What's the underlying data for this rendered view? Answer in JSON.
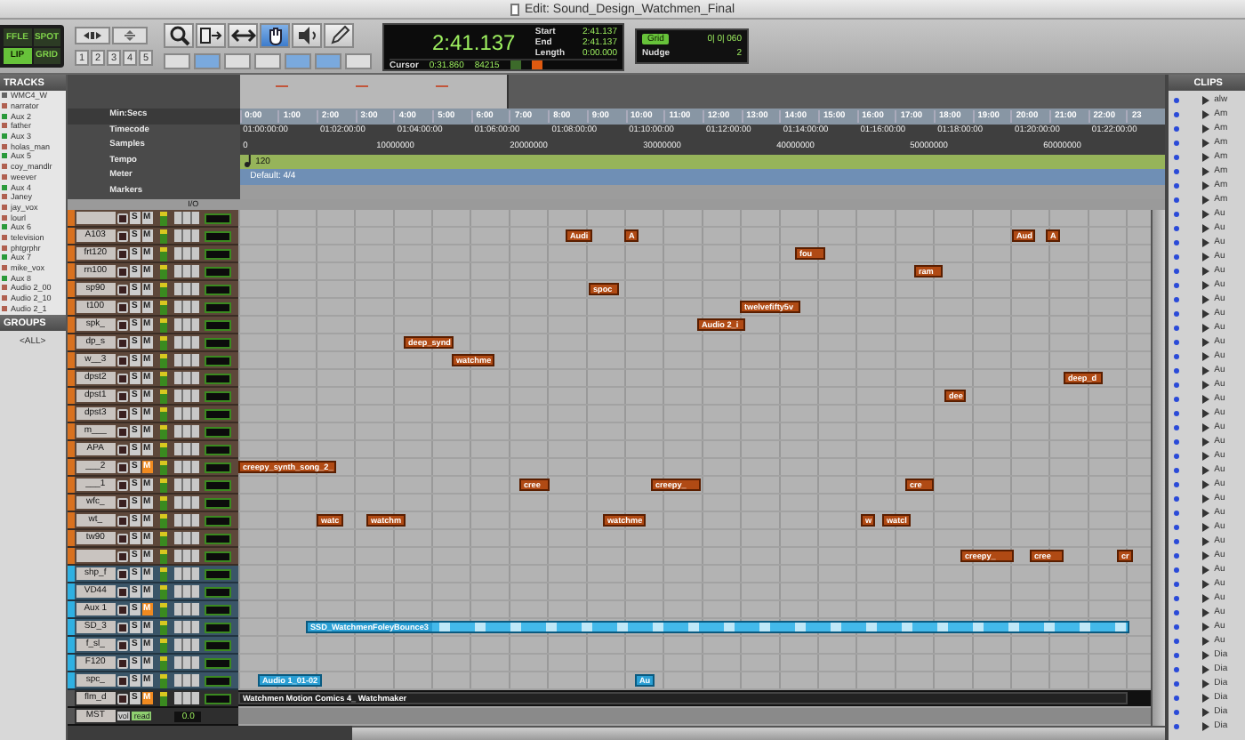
{
  "window": {
    "title": "Edit: Sound_Design_Watchmen_Final"
  },
  "toolbar": {
    "edit_modes": [
      {
        "label": "FFLE",
        "selected": false
      },
      {
        "label": "SPOT",
        "selected": false
      },
      {
        "label": "LIP",
        "selected": true
      },
      {
        "label": "GRID",
        "selected": false
      }
    ],
    "zoom_presets": [
      "1",
      "2",
      "3",
      "4",
      "5"
    ],
    "toggles": [
      {
        "on": false
      },
      {
        "on": true
      },
      {
        "on": false
      },
      {
        "on": false
      },
      {
        "on": true
      },
      {
        "on": true
      },
      {
        "on": false
      }
    ],
    "tools": [
      {
        "kind": "zoom",
        "selected": false
      },
      {
        "kind": "trim",
        "selected": false
      },
      {
        "kind": "select",
        "selected": false
      },
      {
        "kind": "grabber",
        "selected": true
      },
      {
        "kind": "scrub",
        "selected": false
      },
      {
        "kind": "pencil",
        "selected": false
      }
    ]
  },
  "counter": {
    "main": "2:41.137",
    "start_label": "Start",
    "start": "2:41.137",
    "end_label": "End",
    "end": "2:41.137",
    "length_label": "Length",
    "length": "0:00.000",
    "cursor_label": "Cursor",
    "cursor": "0:31.860",
    "sample": "84215"
  },
  "grid": {
    "label": "Grid",
    "value": "0| 0| 060",
    "nudge_label": "Nudge",
    "nudge": "2"
  },
  "tracks_panel": {
    "title": "TRACKS",
    "items": [
      {
        "name": "WMC4_W",
        "kind": "video"
      },
      {
        "name": "narrator",
        "kind": "audio"
      },
      {
        "name": "Aux 2",
        "kind": "aux"
      },
      {
        "name": "father",
        "kind": "audio"
      },
      {
        "name": "Aux 3",
        "kind": "aux"
      },
      {
        "name": "holas_man",
        "kind": "audio"
      },
      {
        "name": "Aux 5",
        "kind": "aux"
      },
      {
        "name": "coy_mandlr",
        "kind": "audio"
      },
      {
        "name": "weever",
        "kind": "audio"
      },
      {
        "name": "Aux 4",
        "kind": "aux"
      },
      {
        "name": "Janey",
        "kind": "audio"
      },
      {
        "name": "jay_vox",
        "kind": "audio"
      },
      {
        "name": "lourl",
        "kind": "audio"
      },
      {
        "name": "Aux 6",
        "kind": "aux"
      },
      {
        "name": "television",
        "kind": "audio"
      },
      {
        "name": "phtgrphr",
        "kind": "audio"
      },
      {
        "name": "Aux 7",
        "kind": "aux"
      },
      {
        "name": "mike_vox",
        "kind": "audio"
      },
      {
        "name": "Aux 8",
        "kind": "aux"
      },
      {
        "name": "Audio 2_00",
        "kind": "audio"
      },
      {
        "name": "Audio 2_10",
        "kind": "audio"
      },
      {
        "name": "Audio 2_1",
        "kind": "audio"
      }
    ]
  },
  "groups_panel": {
    "title": "GROUPS",
    "items": [
      "<ALL>"
    ]
  },
  "rulers": [
    {
      "label": "Min:Secs",
      "kind": "minsecs",
      "ticks": [
        "0:00",
        "1:00",
        "2:00",
        "3:00",
        "4:00",
        "5:00",
        "6:00",
        "7:00",
        "8:00",
        "9:00",
        "10:00",
        "11:00",
        "12:00",
        "13:00",
        "14:00",
        "15:00",
        "16:00",
        "17:00",
        "18:00",
        "19:00",
        "20:00",
        "21:00",
        "22:00",
        "23"
      ]
    },
    {
      "label": "Timecode",
      "kind": "timecode",
      "ticks": [
        "01:00:00:00",
        "01:02:00:00",
        "01:04:00:00",
        "01:06:00:00",
        "01:08:00:00",
        "01:10:00:00",
        "01:12:00:00",
        "01:14:00:00",
        "01:16:00:00",
        "01:18:00:00",
        "01:20:00:00",
        "01:22:00:00"
      ]
    },
    {
      "label": "Samples",
      "kind": "samples",
      "ticks": [
        "0",
        "10000000",
        "20000000",
        "30000000",
        "40000000",
        "50000000",
        "60000000"
      ]
    },
    {
      "label": "Tempo",
      "kind": "tempo",
      "value": "120"
    },
    {
      "label": "Meter",
      "kind": "meter",
      "value": "Default: 4/4"
    },
    {
      "label": "Markers",
      "kind": "markers"
    }
  ],
  "track_header": {
    "io_label": "I/O"
  },
  "tracks": [
    {
      "kind": "audio",
      "solo": "S",
      "mute": "M",
      "muted": false
    },
    {
      "name": "A103",
      "kind": "audio",
      "solo": "S",
      "mute": "M",
      "muted": false,
      "clips": [
        {
          "label": "Audi"
        },
        {
          "label": "A"
        },
        {
          "label": "Aud"
        },
        {
          "label": "A"
        }
      ]
    },
    {
      "name": "frt120",
      "kind": "audio",
      "solo": "S",
      "mute": "M",
      "muted": false,
      "clips": [
        {
          "label": "fou"
        }
      ]
    },
    {
      "name": "rn100",
      "kind": "audio",
      "solo": "S",
      "mute": "M",
      "muted": false,
      "clips": [
        {
          "label": "ram"
        }
      ]
    },
    {
      "name": "sp90",
      "kind": "audio",
      "solo": "S",
      "mute": "M",
      "muted": false,
      "clips": [
        {
          "label": "spoc"
        }
      ]
    },
    {
      "name": "t100",
      "kind": "audio",
      "solo": "S",
      "mute": "M",
      "muted": false,
      "clips": [
        {
          "label": "twelvefifty5v"
        }
      ]
    },
    {
      "name": "spk_",
      "kind": "audio",
      "solo": "S",
      "mute": "M",
      "muted": false,
      "clips": [
        {
          "label": "Audio 2_i"
        }
      ]
    },
    {
      "name": "dp_s",
      "kind": "audio",
      "solo": "S",
      "mute": "M",
      "muted": false,
      "clips": [
        {
          "label": "deep_synd"
        }
      ]
    },
    {
      "name": "w__3",
      "kind": "audio",
      "solo": "S",
      "mute": "M",
      "muted": false,
      "clips": [
        {
          "label": "watchme"
        }
      ]
    },
    {
      "name": "dpst2",
      "kind": "audio",
      "solo": "S",
      "mute": "M",
      "muted": false,
      "clips": [
        {
          "label": "deep_d"
        }
      ]
    },
    {
      "name": "dpst1",
      "kind": "audio",
      "solo": "S",
      "mute": "M",
      "muted": false,
      "clips": [
        {
          "label": "dee"
        }
      ]
    },
    {
      "name": "dpst3",
      "kind": "audio",
      "solo": "S",
      "mute": "M",
      "muted": false
    },
    {
      "name": "m___",
      "kind": "audio",
      "solo": "S",
      "mute": "M",
      "muted": false
    },
    {
      "name": "APA",
      "kind": "audio",
      "solo": "S",
      "mute": "M",
      "muted": false
    },
    {
      "name": "___2",
      "kind": "audio",
      "solo": "S",
      "mute": "M",
      "muted": true,
      "clips": [
        {
          "label": "creepy_synth_song_2_"
        }
      ]
    },
    {
      "name": "___1",
      "kind": "audio",
      "solo": "S",
      "mute": "M",
      "muted": false,
      "clips": [
        {
          "label": "cree"
        },
        {
          "label": "creepy_"
        },
        {
          "label": "cre"
        }
      ]
    },
    {
      "name": "wfc_",
      "kind": "audio",
      "solo": "S",
      "mute": "M",
      "muted": false
    },
    {
      "name": "wt_",
      "kind": "audio",
      "solo": "S",
      "mute": "M",
      "muted": false,
      "clips": [
        {
          "label": "watc"
        },
        {
          "label": "watchm"
        },
        {
          "label": "watchme"
        },
        {
          "label": "w"
        },
        {
          "label": "watcl"
        }
      ]
    },
    {
      "name": "tw90",
      "kind": "audio",
      "solo": "S",
      "mute": "M",
      "muted": false
    },
    {
      "kind": "audio",
      "solo": "S",
      "mute": "M",
      "muted": false,
      "clips": [
        {
          "label": "creepy_"
        },
        {
          "label": "cree"
        },
        {
          "label": "cr"
        }
      ]
    },
    {
      "name": "shp_f",
      "kind": "aux",
      "solo": "S",
      "mute": "M",
      "muted": false
    },
    {
      "name": "VD44",
      "kind": "aux",
      "solo": "S",
      "mute": "M",
      "muted": false
    },
    {
      "name": "Aux 1",
      "kind": "aux",
      "solo": "S",
      "mute": "M",
      "muted": true
    },
    {
      "name": "SD_3",
      "kind": "aux",
      "solo": "S",
      "mute": "M",
      "muted": false,
      "clips": [
        {
          "label": "SSD_WatchmenFoleyBounce3"
        }
      ]
    },
    {
      "name": "f_sl_",
      "kind": "aux",
      "solo": "S",
      "mute": "M",
      "muted": false
    },
    {
      "name": "F120",
      "kind": "aux",
      "solo": "S",
      "mute": "M",
      "muted": false
    },
    {
      "name": "spc_",
      "kind": "aux",
      "solo": "S",
      "mute": "M",
      "muted": false,
      "clips": [
        {
          "label": "Audio 1_01-02"
        },
        {
          "label": "Au"
        }
      ]
    },
    {
      "name": "flm_d",
      "kind": "video",
      "solo": "S",
      "mute": "M",
      "muted": true,
      "clips": [
        {
          "label": "Watchmen Motion Comics 4_ Watchmaker"
        }
      ]
    },
    {
      "name": "MST",
      "kind": "master",
      "automation": "vol",
      "mode": "read",
      "output": "0.0"
    }
  ],
  "clips_panel": {
    "title": "CLIPS",
    "items": [
      "alw",
      "Am",
      "Am",
      "Am",
      "Am",
      "Am",
      "Am",
      "Am",
      "Au",
      "Au",
      "Au",
      "Au",
      "Au",
      "Au",
      "Au",
      "Au",
      "Au",
      "Au",
      "Au",
      "Au",
      "Au",
      "Au",
      "Au",
      "Au",
      "Au",
      "Au",
      "Au",
      "Au",
      "Au",
      "Au",
      "Au",
      "Au",
      "Au",
      "Au",
      "Au",
      "Au",
      "Au",
      "Au",
      "Au",
      "Dia",
      "Dia",
      "Dia",
      "Dia",
      "Dia",
      "Dia"
    ]
  }
}
